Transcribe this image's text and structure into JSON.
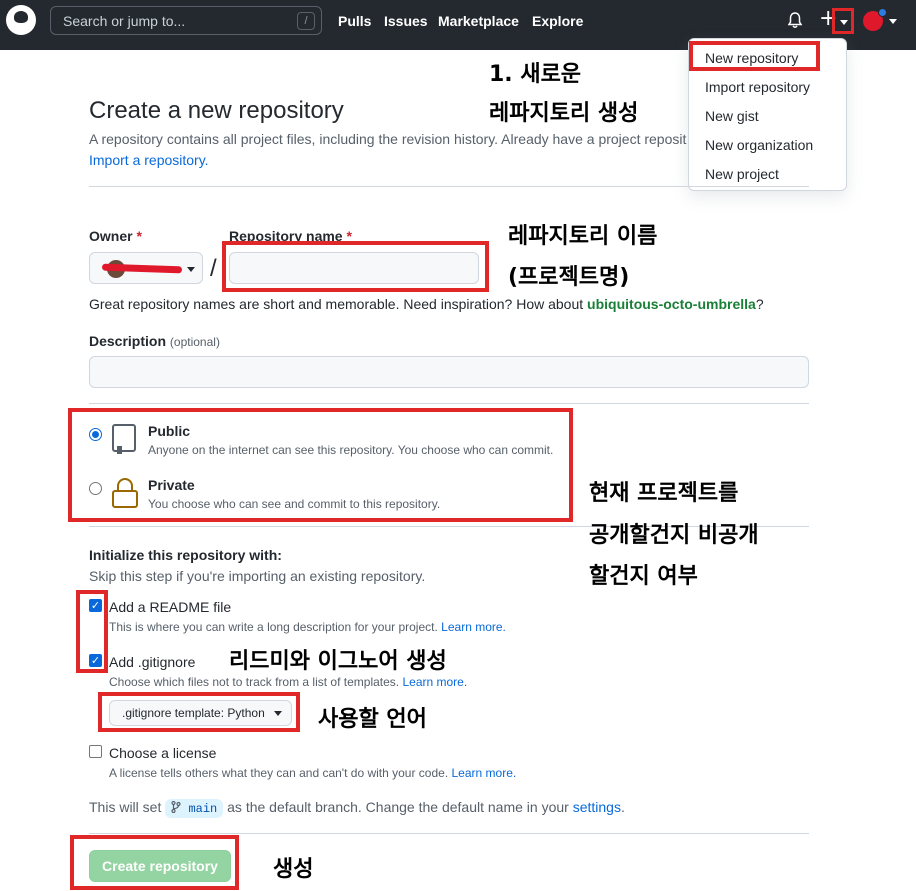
{
  "header": {
    "search_placeholder": "Search or jump to...",
    "search_key": "/",
    "nav": [
      "Pulls",
      "Issues",
      "Marketplace",
      "Explore"
    ],
    "plus": "+"
  },
  "dropdown": {
    "items": [
      "New repository",
      "Import repository",
      "New gist",
      "New organization",
      "New project"
    ]
  },
  "page": {
    "title": "Create a new repository",
    "subtitle": "A repository contains all project files, including the revision history. Already have a project reposit",
    "import_link": "Import a repository.",
    "owner_label": "Owner",
    "repo_label": "Repository name",
    "required_mark": "*",
    "slash": "/",
    "hint_prefix": "Great repository names are short and memorable. Need inspiration? How about ",
    "hint_name": "ubiquitous-octo-umbrella",
    "hint_suffix": "?",
    "description_label": "Description",
    "description_optional": "(optional)",
    "public_title": "Public",
    "public_desc": "Anyone on the internet can see this repository. You choose who can commit.",
    "private_title": "Private",
    "private_desc": "You choose who can see and commit to this repository.",
    "init_title": "Initialize this repository with:",
    "init_desc": "Skip this step if you're importing an existing repository.",
    "readme_label": "Add a README file",
    "readme_desc": "This is where you can write a long description for your project.",
    "learn_more": "Learn more.",
    "gitignore_label": "Add .gitignore",
    "gitignore_desc": "Choose which files not to track from a list of templates.",
    "template_btn": ".gitignore template: Python",
    "license_label": "Choose a license",
    "license_desc": "A license tells others what they can and can't do with your code.",
    "branch_prefix": "This will set ",
    "branch_name": "main",
    "branch_middle": " as the default branch. Change the default name in your ",
    "branch_link": "settings",
    "branch_suffix": ".",
    "create_button": "Create repository"
  },
  "annotations": {
    "new_repo_1": "1. 새로운",
    "new_repo_2": "레파지토리 생성",
    "repo_name_1": "레파지토리 이름",
    "repo_name_2": "(프로젝트명)",
    "visibility_1": "현재 프로젝트를",
    "visibility_2": "공개할건지 비공개",
    "visibility_3": "할건지 여부",
    "readme": "리드미와 이그노어 생성",
    "language": "사용할 언어",
    "create": "생성"
  },
  "colors": {
    "header_bg": "#24292f",
    "annotation_red": "#e02828",
    "link_blue": "#0969da",
    "create_green": "#94d3a2"
  }
}
